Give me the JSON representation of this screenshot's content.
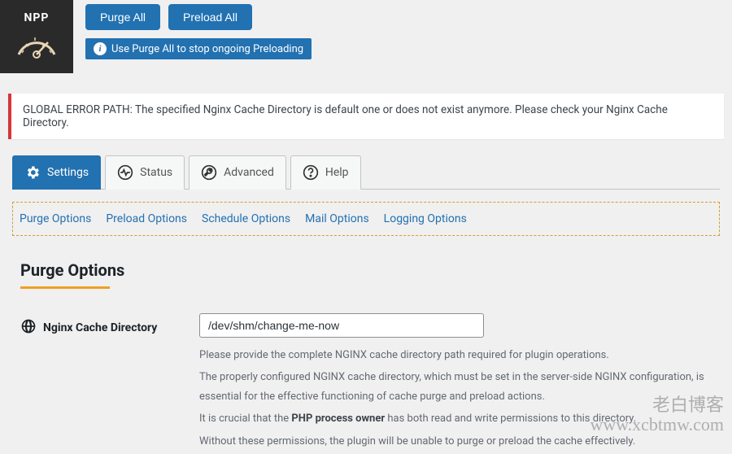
{
  "logo": {
    "label": "NPP"
  },
  "header": {
    "purge_all": "Purge All",
    "preload_all": "Preload All",
    "info_banner": "Use Purge All to stop ongoing Preloading"
  },
  "error": {
    "message": "GLOBAL ERROR PATH: The specified Nginx Cache Directory is default one or does not exist anymore. Please check your Nginx Cache Directory."
  },
  "tabs": {
    "settings": "Settings",
    "status": "Status",
    "advanced": "Advanced",
    "help": "Help"
  },
  "subtabs": {
    "purge": "Purge Options",
    "preload": "Preload Options",
    "schedule": "Schedule Options",
    "mail": "Mail Options",
    "logging": "Logging Options"
  },
  "section": {
    "title": "Purge Options"
  },
  "fields": {
    "cache_dir": {
      "label": "Nginx Cache Directory",
      "value": "/dev/shm/change-me-now",
      "help1": "Please provide the complete NGINX cache directory path required for plugin operations.",
      "help2": "The properly configured NGINX cache directory, which must be set in the server-side NGINX configuration, is essential for the effective functioning of cache purge and preload actions.",
      "help3_pre": "It is crucial that the ",
      "help3_bold": "PHP process owner",
      "help3_post": " has both read and write permissions to this directory.",
      "help4": "Without these permissions, the plugin will be unable to purge or preload the cache effectively."
    }
  },
  "watermark": {
    "line1": "老白博客",
    "line2": "www.xcbtmw.com"
  }
}
